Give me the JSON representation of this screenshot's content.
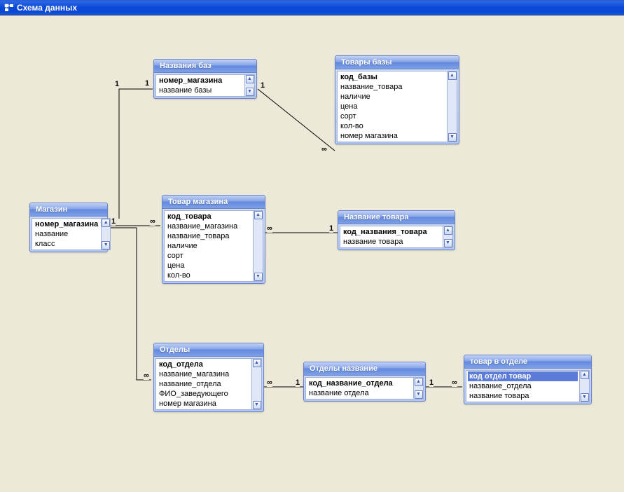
{
  "window": {
    "title": "Схема данных"
  },
  "tables": {
    "nazvaniya_baz": {
      "title": "Названия баз",
      "fields": [
        "номер_магазина",
        "название базы"
      ],
      "pk": [
        0
      ]
    },
    "tovary_bazy": {
      "title": "Товары базы",
      "fields": [
        "код_базы",
        "название_товара",
        "наличие",
        "цена",
        "сорт",
        "кол-во",
        "номер магазина"
      ],
      "pk": [
        0
      ]
    },
    "magazin": {
      "title": "Магазин",
      "fields": [
        "номер_магазина",
        "название",
        "класс"
      ],
      "pk": [
        0
      ]
    },
    "tovar_magazina": {
      "title": "Товар магазина",
      "fields": [
        "код_товара",
        "название_магазина",
        "название_товара",
        "наличие",
        "сорт",
        "цена",
        "кол-во"
      ],
      "pk": [
        0
      ]
    },
    "nazvanie_tovara": {
      "title": "Название товара",
      "fields": [
        "код_названия_товара",
        "название товара"
      ],
      "pk": [
        0
      ]
    },
    "otdely": {
      "title": "Отделы",
      "fields": [
        "код_отдела",
        "название_магазина",
        "название_отдела",
        "ФИО_заведующего",
        "номер магазина"
      ],
      "pk": [
        0
      ]
    },
    "otdely_nazvanie": {
      "title": "Отделы название",
      "fields": [
        "код_название_отдела",
        "название отдела"
      ],
      "pk": [
        0
      ]
    },
    "tovar_v_otdele": {
      "title": "товар в отделе",
      "fields": [
        "код отдел товар",
        "название_отдела",
        "название товара"
      ],
      "pk": [
        0
      ],
      "selected": 0
    }
  },
  "cardinality": {
    "one": "1",
    "many": "∞"
  },
  "relationships": [
    {
      "from": "magazin",
      "to": "nazvaniya_baz",
      "from_card": "1",
      "to_card": "1"
    },
    {
      "from": "nazvaniya_baz",
      "to": "tovary_bazy",
      "from_card": "1",
      "to_card": "∞"
    },
    {
      "from": "magazin",
      "to": "tovar_magazina",
      "from_card": "1",
      "to_card": "∞"
    },
    {
      "from": "tovar_magazina",
      "to": "nazvanie_tovara",
      "from_card": "∞",
      "to_card": "1"
    },
    {
      "from": "magazin",
      "to": "otdely",
      "from_card": "1",
      "to_card": "∞"
    },
    {
      "from": "otdely",
      "to": "otdely_nazvanie",
      "from_card": "∞",
      "to_card": "1"
    },
    {
      "from": "otdely_nazvanie",
      "to": "tovar_v_otdele",
      "from_card": "1",
      "to_card": "∞"
    }
  ]
}
